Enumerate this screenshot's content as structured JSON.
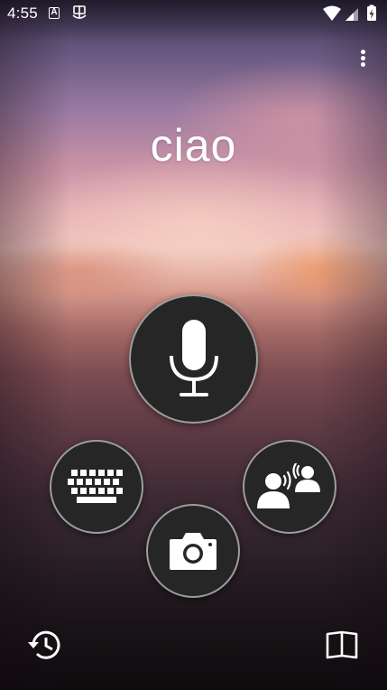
{
  "status_bar": {
    "time": "4:55",
    "notification_icons": [
      "translate-a-icon",
      "app-notification-icon"
    ],
    "system_icons": [
      "wifi-icon",
      "cellular-signal-icon",
      "battery-charging-icon"
    ]
  },
  "app": {
    "recognized_text": "ciao",
    "overflow_menu_icon": "more-vert-icon"
  },
  "actions": {
    "microphone": {
      "icon": "microphone-icon"
    },
    "keyboard": {
      "icon": "keyboard-icon"
    },
    "conversation": {
      "icon": "conversation-icon"
    },
    "camera": {
      "icon": "camera-icon"
    }
  },
  "bottom_bar": {
    "history": {
      "icon": "history-icon"
    },
    "phrasebook": {
      "icon": "phrasebook-icon"
    }
  },
  "colors": {
    "button_background": "#262626",
    "icon": "#ffffff",
    "text": "#ffffff"
  }
}
